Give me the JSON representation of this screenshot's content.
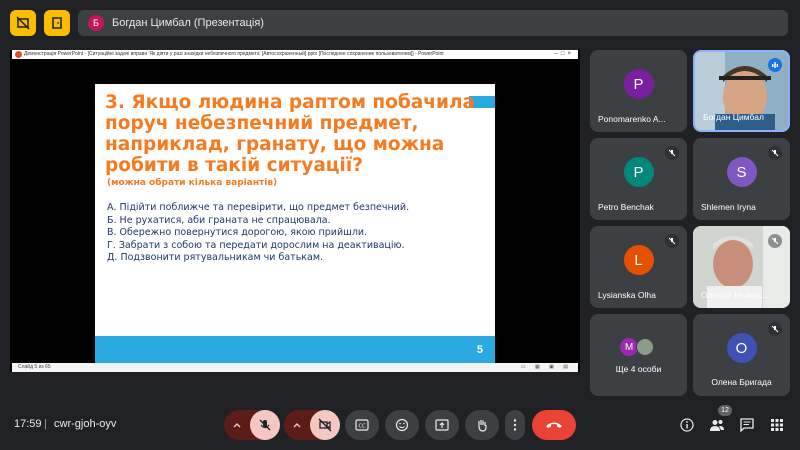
{
  "header": {
    "presenter_initial": "Б",
    "presenter_label": "Богдан Цимбал (Презентація)",
    "accent_color": "#fbbc04"
  },
  "ppt_window": {
    "title": "Демонстрація PowerPoint - [Ситуаційні задачі вправи 'Як діяти у разі знахідки небезпечного предмета' [Автосохраненный].pptx [Последнее сохранение пользователем]] - PowerPoint",
    "status": "Слайд 5 из 65"
  },
  "slide": {
    "title": "3. Якщо людина раптом побачила поруч небезпечний предмет, наприклад, гранату, що можна робити в такій ситуації?",
    "subtitle": "(можна обрати кілька варіантів)",
    "options": [
      "А. Підійти поближче та перевірити, що предмет безпечний.",
      "Б. Не рухатися, аби граната не спрацювала.",
      "В. Обережно повернутися дорогою, якою прийшли.",
      "Г. Забрати з собою та передати дорослим на деактивацію.",
      "Д. Подзвонити рятувальникам чи батькам."
    ],
    "number": "5",
    "title_color": "#f47b20",
    "footer_color": "#29a9e0"
  },
  "participants": [
    {
      "initial": "P",
      "name": "Ponomarenko A...",
      "color": "#7b1fa2",
      "muted": false
    },
    {
      "initial": "",
      "name": "Богдан Цимбал",
      "color": "",
      "muted": false,
      "speaking": true
    },
    {
      "initial": "P",
      "name": "Petro Benchak",
      "color": "#00897b",
      "muted": true
    },
    {
      "initial": "S",
      "name": "Shlemen Iryna",
      "color": "#7e57c2",
      "muted": true
    },
    {
      "initial": "L",
      "name": "Lysianska Olha",
      "color": "#e65100",
      "muted": true
    },
    {
      "initial": "",
      "name": "Олексій Ільїнсь...",
      "color": "",
      "muted": true
    },
    {
      "initial": "M",
      "name": "Ще 4 особи",
      "color": "#9c27b0",
      "muted": true
    },
    {
      "initial": "O",
      "name": "Олена Бригада",
      "color": "#3f51b5",
      "muted": true
    }
  ],
  "footer": {
    "time": "17:59",
    "separator": "|",
    "meeting_code": "cwr-gjoh-oyv",
    "people_count": "12"
  },
  "icons": [
    "hide-self-icon",
    "exit-icon",
    "mic-off-icon",
    "camera-off-icon",
    "captions-icon",
    "emoji-icon",
    "present-icon",
    "raise-hand-icon",
    "more-icon",
    "end-call-icon",
    "info-icon",
    "people-icon",
    "chat-icon",
    "activities-icon"
  ]
}
